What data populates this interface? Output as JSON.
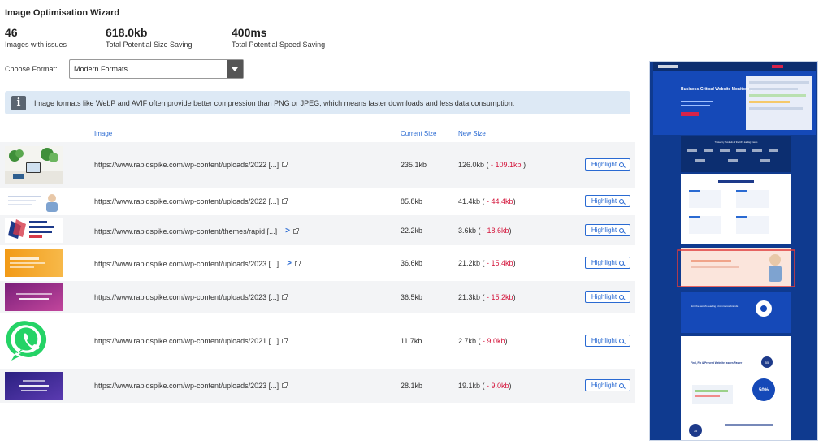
{
  "title": "Image Optimisation Wizard",
  "stats": [
    {
      "value": "46",
      "label": "Images with issues"
    },
    {
      "value": "618.0kb",
      "label": "Total Potential Size Saving"
    },
    {
      "value": "400ms",
      "label": "Total Potential Speed Saving"
    }
  ],
  "format": {
    "label": "Choose Format:",
    "selected": "Modern Formats"
  },
  "info": {
    "icon": "info-icon",
    "text": "Image formats like WebP and AVIF often provide better compression than PNG or JPEG, which means faster downloads and less data consumption."
  },
  "table": {
    "headers": {
      "image": "Image",
      "current": "Current Size",
      "new": "New Size"
    },
    "rows": [
      {
        "url": "https://www.rapidspike.com/wp-content/uploads/2022 [...]",
        "chevron": false,
        "current": "235.1kb",
        "new": "126.0kb (",
        "saving": " - 109.1kb",
        "close": " )",
        "button": "Highlight",
        "thumb": "desk-photo"
      },
      {
        "url": "https://www.rapidspike.com/wp-content/uploads/2022 [...]",
        "chevron": false,
        "current": "85.8kb",
        "new": "41.4kb (",
        "saving": " - 44.4kb",
        "close": ")",
        "button": "Highlight",
        "thumb": "person-dashboard"
      },
      {
        "url": "https://www.rapidspike.com/wp-content/themes/rapid [...]",
        "chevron": true,
        "current": "22.2kb",
        "new": "3.6kb (",
        "saving": " - 18.6kb",
        "close": ")",
        "button": "Highlight",
        "thumb": "award-badge"
      },
      {
        "url": "https://www.rapidspike.com/wp-content/uploads/2023 [...]",
        "chevron": true,
        "current": "36.6kb",
        "new": "21.2kb (",
        "saving": " - 15.4kb",
        "close": ")",
        "button": "Highlight",
        "thumb": "orange-banner"
      },
      {
        "url": "https://www.rapidspike.com/wp-content/uploads/2023 [...]",
        "chevron": false,
        "current": "36.5kb",
        "new": "21.3kb (",
        "saving": " - 15.2kb",
        "close": ")",
        "button": "Highlight",
        "thumb": "purple-banner"
      },
      {
        "url": "https://www.rapidspike.com/wp-content/uploads/2021 [...]",
        "chevron": false,
        "current": "11.7kb",
        "new": "2.7kb (",
        "saving": " - 9.0kb",
        "close": ")",
        "button": "Highlight",
        "thumb": "whatsapp-logo"
      },
      {
        "url": "https://www.rapidspike.com/wp-content/uploads/2023 [...]",
        "chevron": false,
        "current": "28.1kb",
        "new": "19.1kb (",
        "saving": " - 9.0kb",
        "close": ")",
        "button": "Highlight",
        "thumb": "blue-banner"
      }
    ]
  },
  "preview": {
    "hero_title": "Business-Critical Website Monitoring",
    "clients_text": "Trusted by hundreds of the UK's leading brands",
    "join_text": "Join the world's leading eCommerce brands",
    "card_title": "Find, Fix & Prevent Website Issues Faster",
    "stat_a": "50%",
    "stat_b": "75",
    "stat_c": "55"
  },
  "colors": {
    "accent": "#2a6ad2",
    "saving": "#d4163c",
    "info_bg": "#dde9f5",
    "preview_bg": "#0f3a8f",
    "highlight_box": "#e03a3a"
  }
}
